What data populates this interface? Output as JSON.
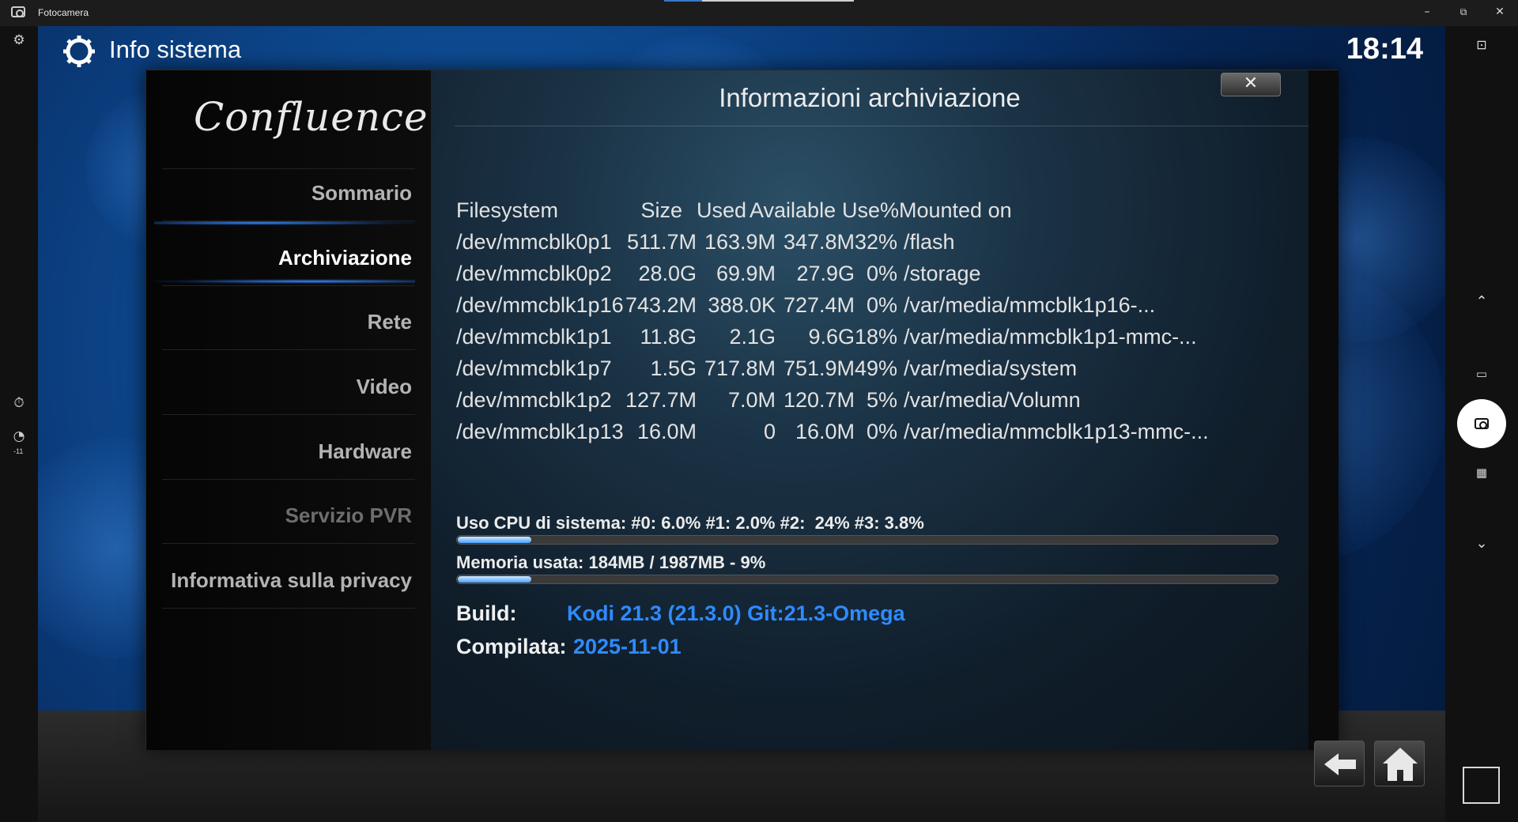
{
  "window": {
    "app_title": "Fotocamera",
    "controls": {
      "minimize": "–",
      "restore": "⧉",
      "close": "✕"
    }
  },
  "camera_left": {
    "icons": [
      "gear-icon",
      "timer-off-icon",
      "exposure-icon"
    ],
    "exposure_value": "-11"
  },
  "camera_right": {
    "icons": [
      "settings-camera-icon",
      "chevron-up-icon",
      "video-icon",
      "photo-capture-icon",
      "qr-code-icon",
      "chevron-down-icon"
    ]
  },
  "kodi": {
    "header_title": "Info sistema",
    "clock": "18:14",
    "logo_text": "Confluence",
    "menu": [
      {
        "label": "Sommario",
        "active": false,
        "disabled": false
      },
      {
        "label": "Archiviazione",
        "active": true,
        "disabled": false
      },
      {
        "label": "Rete",
        "active": false,
        "disabled": false
      },
      {
        "label": "Video",
        "active": false,
        "disabled": false
      },
      {
        "label": "Hardware",
        "active": false,
        "disabled": false
      },
      {
        "label": "Servizio PVR",
        "active": false,
        "disabled": true
      },
      {
        "label": "Informativa sulla privacy",
        "active": false,
        "disabled": false
      }
    ],
    "dialog_title": "Informazioni archiviazione",
    "close_label": "✕",
    "storage_table": {
      "headers": [
        "Filesystem",
        "Size",
        "Used",
        "Available",
        "Use%",
        "Mounted on"
      ],
      "rows": [
        [
          "/dev/mmcblk0p1",
          "511.7M",
          "163.9M",
          "347.8M",
          "32%",
          "/flash"
        ],
        [
          "/dev/mmcblk0p2",
          "28.0G",
          "69.9M",
          "27.9G",
          "0%",
          "/storage"
        ],
        [
          "/dev/mmcblk1p16",
          "743.2M",
          "388.0K",
          "727.4M",
          "0%",
          "/var/media/mmcblk1p16-..."
        ],
        [
          "/dev/mmcblk1p1",
          "11.8G",
          "2.1G",
          "9.6G",
          "18%",
          "/var/media/mmcblk1p1-mmc-..."
        ],
        [
          "/dev/mmcblk1p7",
          "1.5G",
          "717.8M",
          "751.9M",
          "49%",
          "/var/media/system"
        ],
        [
          "/dev/mmcblk1p2",
          "127.7M",
          "7.0M",
          "120.7M",
          "5%",
          "/var/media/Volumn"
        ],
        [
          "/dev/mmcblk1p13",
          "16.0M",
          "0",
          "16.0M",
          "0%",
          "/var/media/mmcblk1p13-mmc-..."
        ]
      ]
    },
    "cpu_usage_text": "Uso CPU di sistema: #0: 6.0% #1: 2.0% #2:  24% #3: 3.8%",
    "cpu_bar_fraction": 0.09,
    "memory_text": "Memoria usata: 184MB / 1987MB - 9%",
    "memory_bar_fraction": 0.09,
    "build_label": "Build:",
    "build_value": "Kodi 21.3 (21.3.0) Git:21.3-Omega",
    "compiled_label": "Compilata:",
    "compiled_value": "2025-11-01",
    "nav_buttons": [
      "back-arrow-icon",
      "home-icon"
    ],
    "colors": {
      "accent_blue": "#2f8bff",
      "menu_active": "#ffffff",
      "menu_inactive": "#b3b3b3",
      "menu_disabled": "#6d6d6d"
    }
  }
}
